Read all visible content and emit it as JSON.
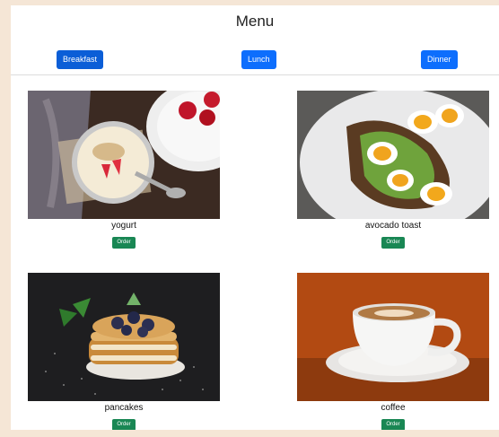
{
  "header": {
    "title": "Menu"
  },
  "tabs": [
    {
      "label": "Breakfast",
      "active": true
    },
    {
      "label": "Lunch",
      "active": false
    },
    {
      "label": "Dinner",
      "active": false
    }
  ],
  "items": [
    {
      "name": "yogurt",
      "order_label": "Order",
      "photo": "yogurt-photo"
    },
    {
      "name": "avocado toast",
      "order_label": "Order",
      "photo": "avocado-toast-photo"
    },
    {
      "name": "pancakes",
      "order_label": "Order",
      "photo": "pancakes-photo"
    },
    {
      "name": "coffee",
      "order_label": "Order",
      "photo": "coffee-photo"
    }
  ],
  "colors": {
    "page_background": "#f5e6d6",
    "primary_button": "#0d6efd",
    "order_button": "#198754"
  }
}
